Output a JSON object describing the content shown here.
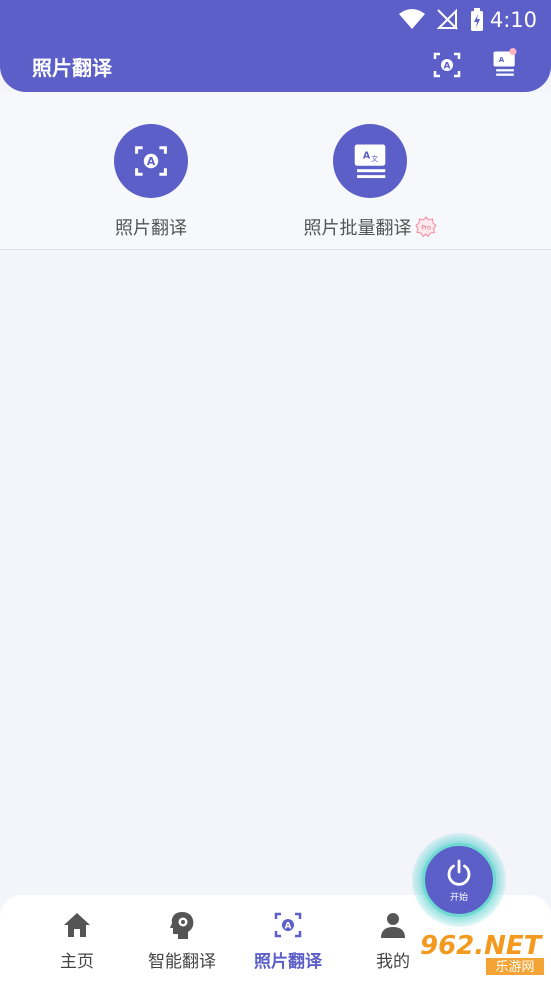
{
  "status": {
    "time": "4:10"
  },
  "app": {
    "title": "照片翻译"
  },
  "tools": [
    {
      "label": "照片翻译",
      "icon": "camera-translate-icon"
    },
    {
      "label": "照片批量翻译",
      "icon": "batch-translate-icon",
      "badge": "Pro"
    }
  ],
  "nav": [
    {
      "label": "主页",
      "icon": "home-icon"
    },
    {
      "label": "智能翻译",
      "icon": "ai-head-icon"
    },
    {
      "label": "照片翻译",
      "icon": "camera-translate-icon",
      "active": true
    },
    {
      "label": "我的",
      "icon": "person-icon"
    }
  ],
  "fab": {
    "label": "开始",
    "icon": "power-icon"
  },
  "watermark": {
    "text": "962.NET",
    "sub": "乐游网"
  },
  "colors": {
    "primary": "#5b5fc7",
    "accent": "#6fd9d2",
    "background": "#f4f5fa"
  }
}
